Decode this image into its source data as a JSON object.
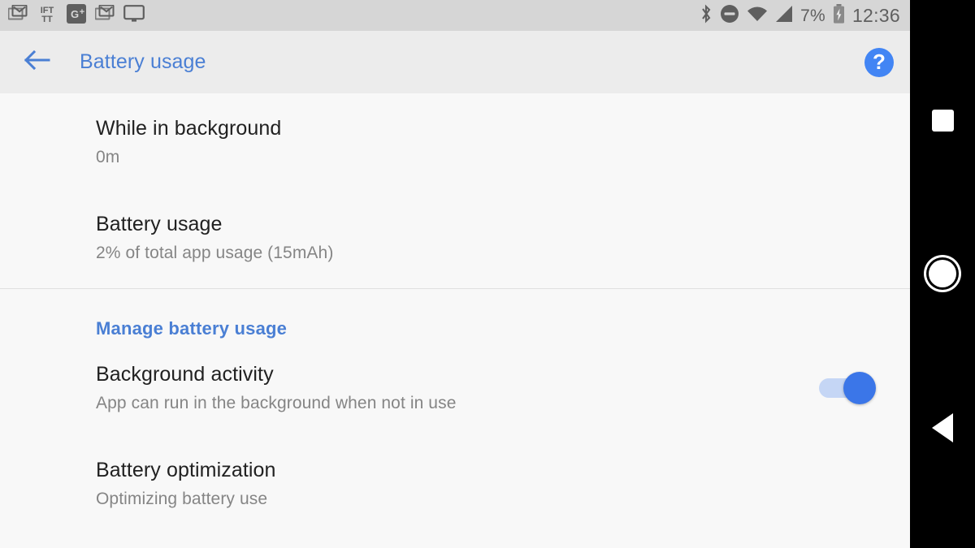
{
  "status_bar": {
    "notification_icons": [
      {
        "name": "gmail-icon",
        "label": "Gmail"
      },
      {
        "name": "ifttt-icon",
        "label": "IFTTT"
      },
      {
        "name": "google-plus-icon",
        "label": "G+"
      },
      {
        "name": "gmail-icon-2",
        "label": "Gmail"
      },
      {
        "name": "cast-monitor-icon",
        "label": "Cast"
      }
    ],
    "system_icons": [
      {
        "name": "bluetooth-icon",
        "label": "Bluetooth"
      },
      {
        "name": "do-not-disturb-icon",
        "label": "Do not disturb"
      },
      {
        "name": "wifi-icon",
        "label": "Wi-Fi"
      },
      {
        "name": "cellular-signal-icon",
        "label": "Cellular signal"
      }
    ],
    "battery_percent": "7%",
    "battery_charging": true,
    "clock": "12:36"
  },
  "app_bar": {
    "title": "Battery usage",
    "back_icon": "arrow-left-icon",
    "help_icon": "question-mark-icon",
    "help_glyph": "?",
    "title_color": "#4a7fd4",
    "accent_color": "#4285f4"
  },
  "content": {
    "sections": [
      {
        "name": "usage-stats",
        "header": null,
        "rows": [
          {
            "name": "while-in-background",
            "title": "While in background",
            "summary": "0m",
            "has_toggle": false
          },
          {
            "name": "battery-usage",
            "title": "Battery usage",
            "summary": "2% of total app usage (15mAh)",
            "has_toggle": false
          }
        ]
      },
      {
        "name": "manage-battery-usage",
        "header": "Manage battery usage",
        "rows": [
          {
            "name": "background-activity",
            "title": "Background activity",
            "summary": "App can run in the background when not in use",
            "has_toggle": true,
            "toggle_on": true
          },
          {
            "name": "battery-optimization",
            "title": "Battery optimization",
            "summary": "Optimizing battery use",
            "has_toggle": false
          }
        ]
      }
    ]
  },
  "nav_bar": {
    "buttons": [
      {
        "name": "recents-button",
        "icon": "square-icon",
        "label": "Overview"
      },
      {
        "name": "home-button",
        "icon": "circle-icon",
        "label": "Home"
      },
      {
        "name": "back-button",
        "icon": "triangle-left-icon",
        "label": "Back"
      }
    ]
  }
}
